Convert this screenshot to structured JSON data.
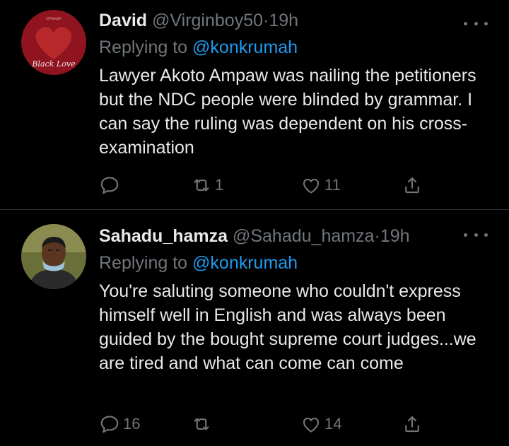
{
  "tweets": [
    {
      "name": "David",
      "handle": "@Virginboy50",
      "separator": "·",
      "time": "19h",
      "replying_prefix": "Replying to",
      "replying_to": "@konkrumah",
      "text": "Lawyer Akoto Ampaw was nailing the petitioners but the NDC people were blinded by grammar. I can say the ruling was dependent on his cross-examination",
      "avatar_text": "Black Love",
      "avatar_colors": {
        "bg": "#8f1420",
        "accent": "#c53030"
      },
      "actions": {
        "replies": "",
        "retweets": "1",
        "likes": "11"
      }
    },
    {
      "name": "Sahadu_hamza",
      "handle": "@Sahadu_hamza",
      "separator": "·",
      "time": "19h",
      "replying_prefix": "Replying to",
      "replying_to": "@konkrumah",
      "text": "You're saluting someone who couldn't express himself well in English and was always been guided by the bought supreme court judges...we are tired and what can come can come",
      "avatar_colors": {
        "bg": "#6a6f3a",
        "skin": "#5a3620",
        "mask": "#9ec4dc"
      },
      "actions": {
        "replies": "16",
        "retweets": "",
        "likes": "14"
      }
    }
  ],
  "colors": {
    "background": "#000000",
    "text": "#e7e9ea",
    "secondary": "#71767b",
    "link": "#1d9bf0",
    "divider": "#2f3336"
  }
}
